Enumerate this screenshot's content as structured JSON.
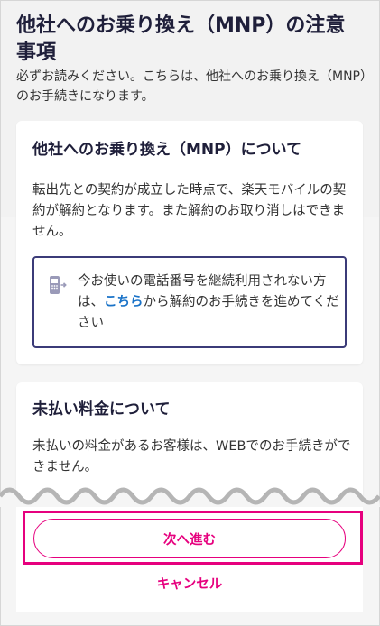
{
  "page": {
    "title": "他社へのお乗り換え（MNP）の注意事項",
    "subtitle": "必ずお読みください。こちらは、他社へのお乗り換え（MNP）のお手続きになります。"
  },
  "mnp_card": {
    "title": "他社へのお乗り換え（MNP）について",
    "body": "転出先との契約が成立した時点で、楽天モバイルの契約が解約となります。また解約のお取り消しはできません。",
    "notice": {
      "text_before": "今お使いの電話番号を継続利用されない方は、",
      "link_label": "こちら",
      "text_after": "から解約のお手続きを進めてください",
      "icon": "phone-arrow-icon"
    }
  },
  "unpaid_card": {
    "title": "未払い料金について",
    "body": "未払いの料金があるお客様は、WEBでのお手続きができません。"
  },
  "actions": {
    "next_label": "次へ進む",
    "cancel_label": "キャンセル"
  },
  "colors": {
    "accent": "#e6007e",
    "navy": "#1f1f3a",
    "notice_border": "#3b3b78",
    "link": "#1a73c8"
  }
}
